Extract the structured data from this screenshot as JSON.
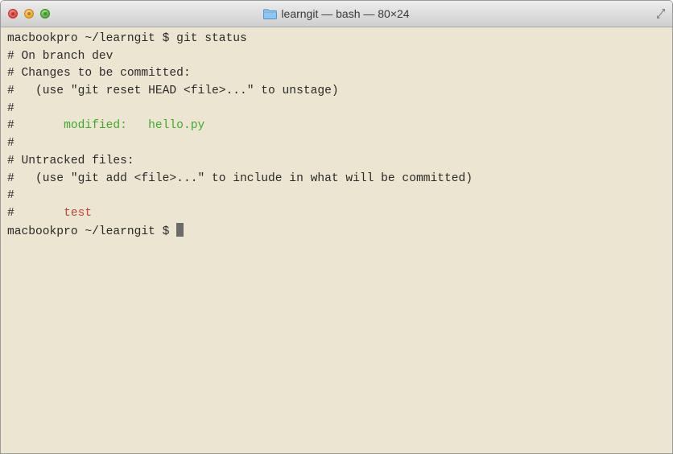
{
  "window": {
    "title": "learngit — bash — 80×24",
    "title_icon": "folder-icon",
    "buttons": [
      {
        "name": "close-button",
        "color": "#e2463f"
      },
      {
        "name": "minimize-button",
        "color": "#e5a521"
      },
      {
        "name": "zoom-button",
        "color": "#4fa83b"
      }
    ],
    "resize_icon": "fullscreen-icon"
  },
  "colors": {
    "background": "#ece5d2",
    "text": "#2a2a2a",
    "green": "#3faa2a",
    "red": "#c1463a",
    "cursor": "#6b6b6b"
  },
  "terminal": {
    "lines": [
      [
        {
          "text": "macbookpro ~/learngit $ git status"
        }
      ],
      [
        {
          "text": "# On branch dev"
        }
      ],
      [
        {
          "text": "# Changes to be committed:"
        }
      ],
      [
        {
          "text": "#   (use \"git reset HEAD <file>...\" to unstage)"
        }
      ],
      [
        {
          "text": "#"
        }
      ],
      [
        {
          "text": "#\t"
        },
        {
          "text": "modified:   hello.py",
          "color": "green"
        }
      ],
      [
        {
          "text": "#"
        }
      ],
      [
        {
          "text": "# Untracked files:"
        }
      ],
      [
        {
          "text": "#   (use \"git add <file>...\" to include in what will be committed)"
        }
      ],
      [
        {
          "text": "#"
        }
      ],
      [
        {
          "text": "#\t"
        },
        {
          "text": "test",
          "color": "red"
        }
      ]
    ],
    "prompt": "macbookpro ~/learngit $ "
  }
}
